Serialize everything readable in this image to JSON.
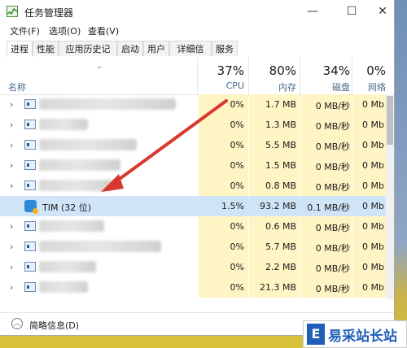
{
  "window": {
    "title": "任务管理器",
    "controls": {
      "minimize": "—",
      "maximize": "☐",
      "close": "✕"
    }
  },
  "menu": [
    "文件(F)",
    "选项(O)",
    "查看(V)"
  ],
  "tabs": [
    "进程",
    "性能",
    "应用历史记录",
    "启动",
    "用户",
    "详细信息",
    "服务"
  ],
  "active_tab": "进程",
  "columns": {
    "name": "名称",
    "cpu": {
      "pct": "37%",
      "label": "CPU"
    },
    "memory": {
      "pct": "80%",
      "label": "内存"
    },
    "disk": {
      "pct": "34%",
      "label": "磁盘"
    },
    "network": {
      "pct": "0%",
      "label": "网络"
    }
  },
  "rows": [
    {
      "name": "",
      "cpu": "0%",
      "mem": "1.7 MB",
      "disk": "0 MB/秒",
      "net": "0 Mb"
    },
    {
      "name": "",
      "cpu": "0%",
      "mem": "1.3 MB",
      "disk": "0 MB/秒",
      "net": "0 Mb"
    },
    {
      "name": "",
      "cpu": "0%",
      "mem": "5.5 MB",
      "disk": "0 MB/秒",
      "net": "0 Mb"
    },
    {
      "name": "",
      "cpu": "0%",
      "mem": "1.5 MB",
      "disk": "0 MB/秒",
      "net": "0 Mb"
    },
    {
      "name": "",
      "cpu": "0%",
      "mem": "0.8 MB",
      "disk": "0 MB/秒",
      "net": "0 Mb"
    },
    {
      "name": "TIM (32 位)",
      "cpu": "1.5%",
      "mem": "93.2 MB",
      "disk": "0.1 MB/秒",
      "net": "0 Mb"
    },
    {
      "name": "",
      "cpu": "0%",
      "mem": "0.6 MB",
      "disk": "0 MB/秒",
      "net": "0 Mb"
    },
    {
      "name": "",
      "cpu": "0%",
      "mem": "5.7 MB",
      "disk": "0 MB/秒",
      "net": "0 Mb"
    },
    {
      "name": "",
      "cpu": "0%",
      "mem": "2.2 MB",
      "disk": "0 MB/秒",
      "net": "0 Mb"
    },
    {
      "name": "",
      "cpu": "0%",
      "mem": "21.3 MB",
      "disk": "0 MB/秒",
      "net": "0 Mb"
    }
  ],
  "footer": {
    "label": "简略信息(D)"
  },
  "watermark": {
    "logo": "E",
    "text": "易采站长站"
  }
}
